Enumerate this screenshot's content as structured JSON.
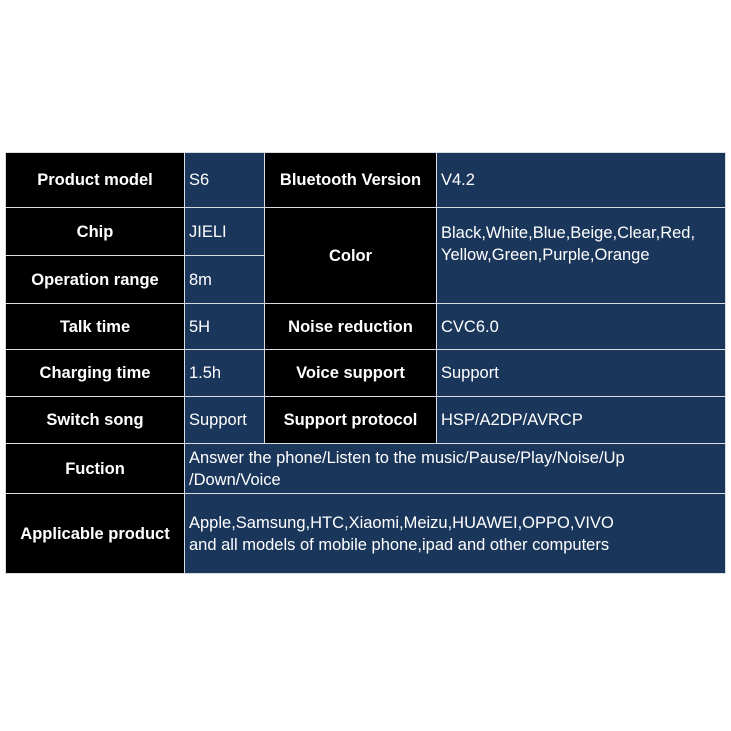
{
  "colors": {
    "label_bg": "#000000",
    "value_bg": "#1b365b",
    "text": "#ffffff",
    "border": "#d8dce4"
  },
  "specs": {
    "product_model": {
      "label": "Product model",
      "value": "S6"
    },
    "bluetooth_version": {
      "label": "Bluetooth Version",
      "value": "V4.2"
    },
    "chip": {
      "label": "Chip",
      "value": "JIELI"
    },
    "color": {
      "label": "Color",
      "value_line1": "Black,White,Blue,Beige,Clear,Red,",
      "value_line2": "Yellow,Green,Purple,Orange"
    },
    "operation_range": {
      "label": "Operation range",
      "value": "8m"
    },
    "talk_time": {
      "label": "Talk time",
      "value": "5H"
    },
    "noise_reduction": {
      "label": "Noise reduction",
      "value": "CVC6.0"
    },
    "charging_time": {
      "label": "Charging time",
      "value": "1.5h"
    },
    "voice_support": {
      "label": "Voice support",
      "value": "Support"
    },
    "switch_song": {
      "label": "Switch song",
      "value": "Support"
    },
    "support_protocol": {
      "label": "Support protocol",
      "value": "HSP/A2DP/AVRCP"
    },
    "function": {
      "label": "Fuction",
      "value_line1": "Answer the phone/Listen to the music/Pause/Play/Noise/Up",
      "value_line2": "/Down/Voice"
    },
    "applicable_product": {
      "label": "Applicable product",
      "value_line1": "Apple,Samsung,HTC,Xiaomi,Meizu,HUAWEI,OPPO,VIVO",
      "value_line2": "and all models of mobile phone,ipad and other computers"
    }
  }
}
